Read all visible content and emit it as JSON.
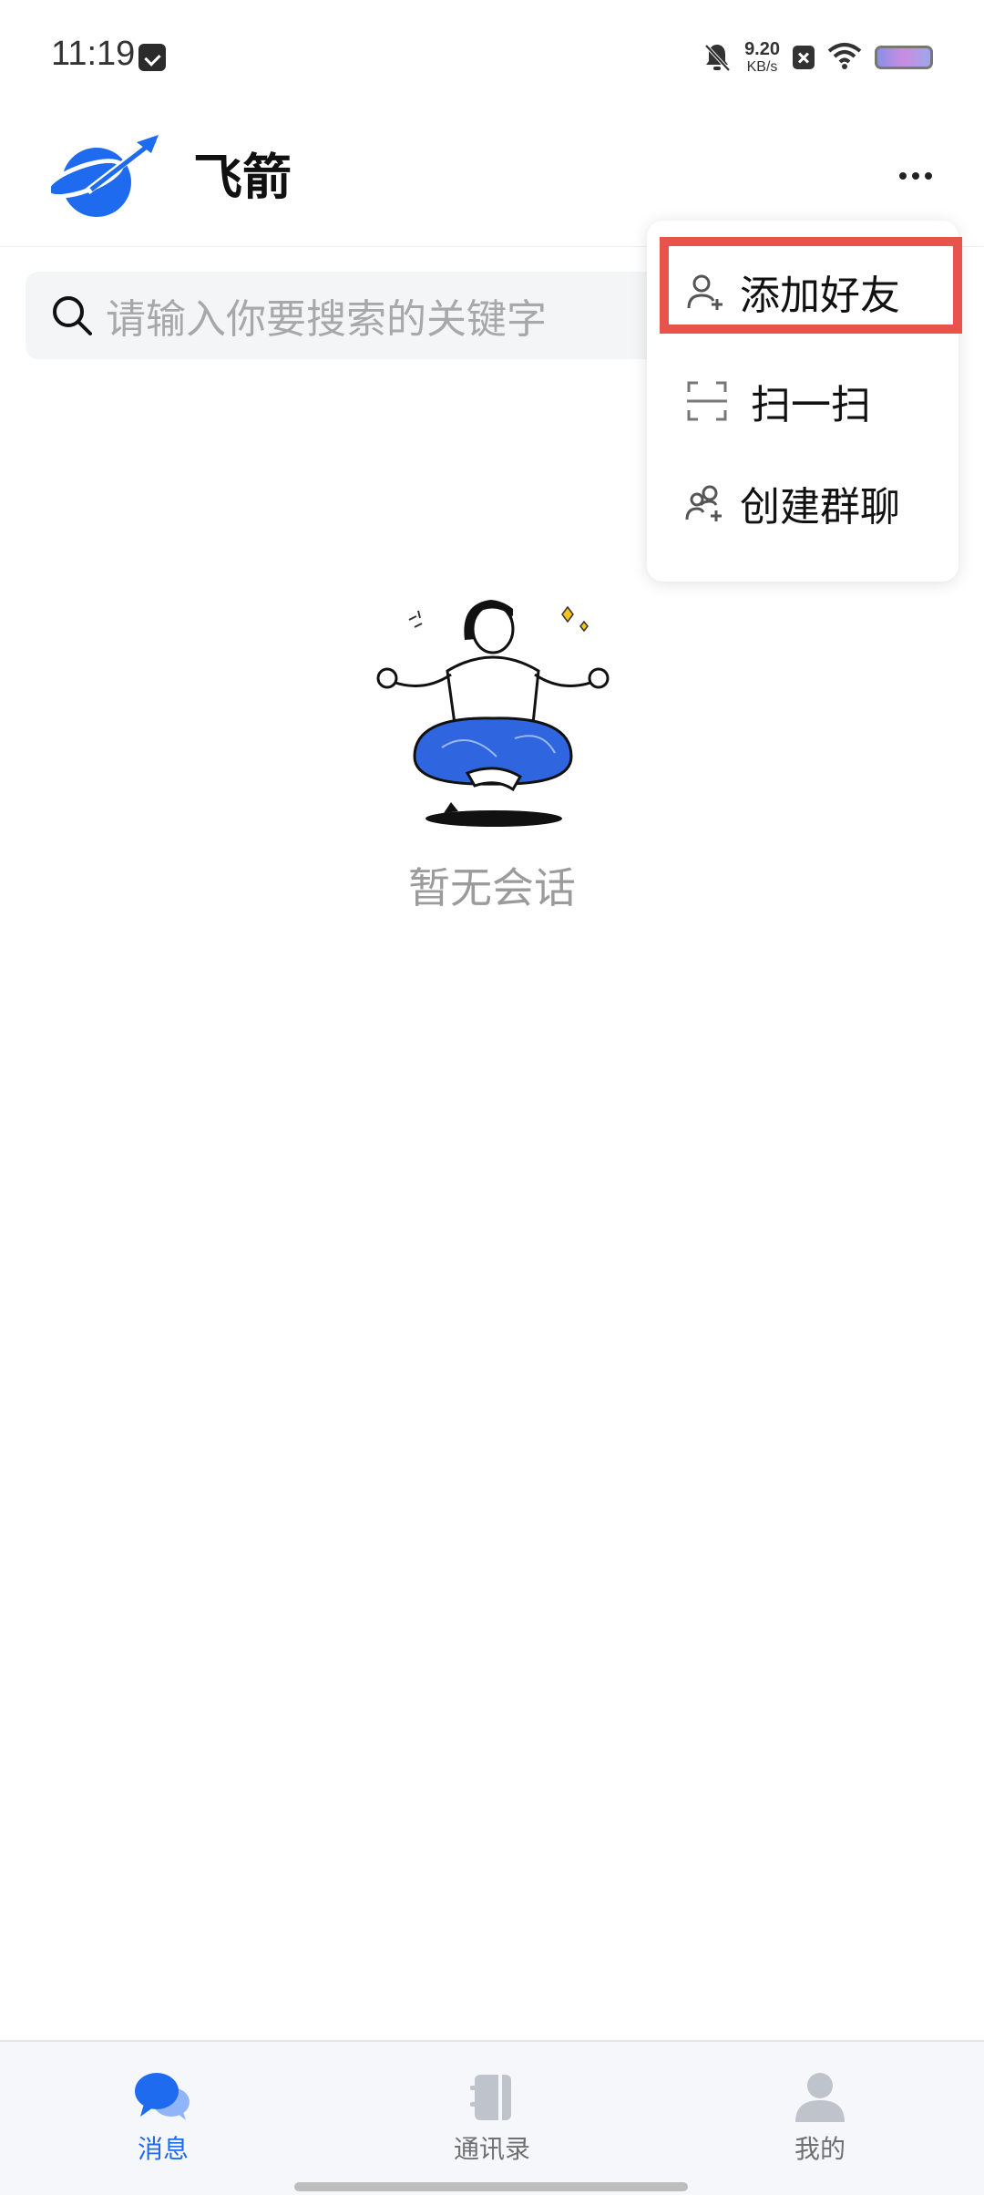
{
  "status_bar": {
    "time": "11:19",
    "net_speed_value": "9.20",
    "net_speed_unit": "KB/s",
    "icons": [
      "app-notification-icon",
      "mute-bell-icon",
      "close-box-icon",
      "wifi-icon",
      "battery-icon"
    ]
  },
  "header": {
    "title": "飞箭",
    "logo": "rocket-logo-icon",
    "more_icon": "more-dots-icon"
  },
  "search": {
    "placeholder": "请输入你要搜索的关键字"
  },
  "empty_state": {
    "text": "暂无会话",
    "illustration": "meditating-person-illustration"
  },
  "menu": {
    "items": [
      {
        "label": "添加好友",
        "icon": "add-user-icon",
        "highlighted": true
      },
      {
        "label": "扫一扫",
        "icon": "scan-icon"
      },
      {
        "label": "创建群聊",
        "icon": "create-group-icon"
      }
    ],
    "highlight_color": "#e8534e"
  },
  "bottom_nav": {
    "tabs": [
      {
        "label": "消息",
        "icon": "messages-icon",
        "active": true
      },
      {
        "label": "通讯录",
        "icon": "contacts-book-icon",
        "active": false
      },
      {
        "label": "我的",
        "icon": "profile-icon",
        "active": false
      }
    ],
    "active_color": "#1e6bf0"
  }
}
